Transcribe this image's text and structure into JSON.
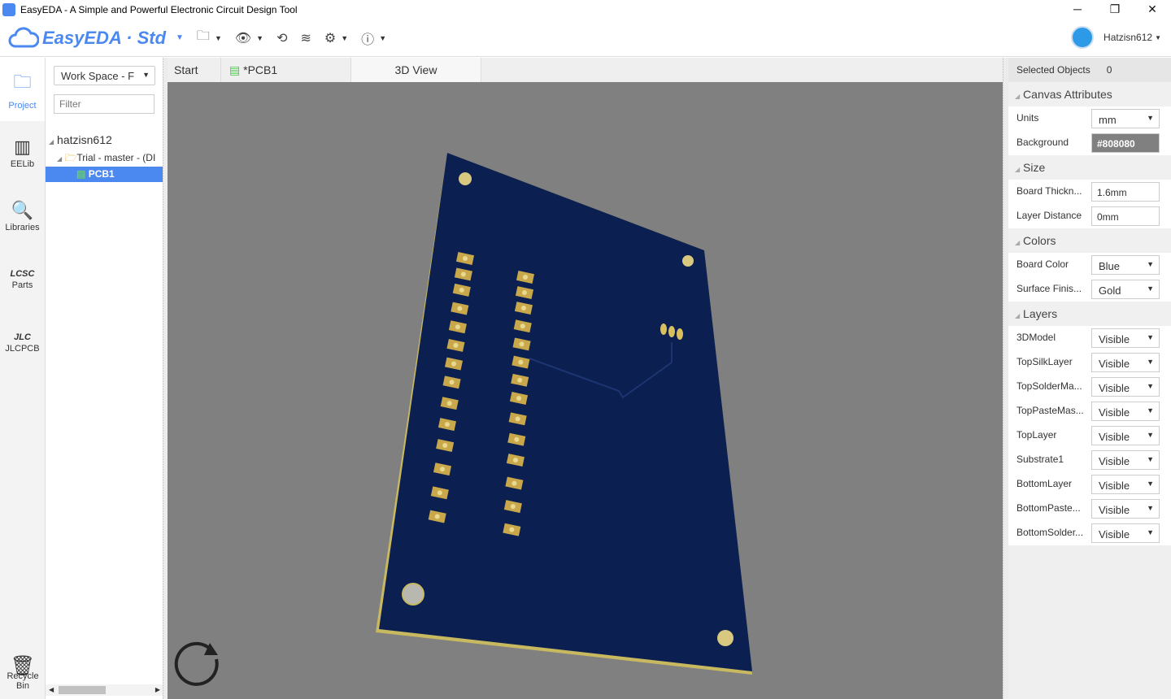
{
  "window": {
    "title": "EasyEDA - A Simple and Powerful Electronic Circuit Design Tool",
    "minimize": "─",
    "restore": "❐",
    "close": "✕"
  },
  "toolbar": {
    "logo": "EasyEDA · Std",
    "user": "Hatzisn612"
  },
  "leftbar": [
    {
      "label": "Project",
      "icon": "folder-icon"
    },
    {
      "label": "EELib",
      "icon": "chip-icon"
    },
    {
      "label": "Libraries",
      "icon": "library-search-icon"
    },
    {
      "label": "Parts",
      "icon": "lcsc-icon"
    },
    {
      "label": "JLCPCB",
      "icon": "jlc-icon"
    }
  ],
  "recycle": {
    "line1": "Recycle",
    "line2": "Bin"
  },
  "project": {
    "workspace": "Work Space - F",
    "filter_placeholder": "Filter",
    "tree": {
      "user": "hatzisn612",
      "project": "Trial - master - (DI",
      "pcb": "PCB1"
    }
  },
  "tabs": [
    {
      "label": "Start"
    },
    {
      "label": "*PCB1"
    },
    {
      "label": "3D View"
    }
  ],
  "panel": {
    "selected_label": "Selected Objects",
    "selected_count": "0",
    "canvas": {
      "title": "Canvas Attributes",
      "units_label": "Units",
      "units": "mm",
      "bg_label": "Background",
      "bg": "#808080"
    },
    "size": {
      "title": "Size",
      "thick_label": "Board Thickn...",
      "thick": "1.6mm",
      "dist_label": "Layer Distance",
      "dist": "0mm"
    },
    "colors": {
      "title": "Colors",
      "board_label": "Board Color",
      "board": "Blue",
      "finish_label": "Surface Finis...",
      "finish": "Gold"
    },
    "layers": {
      "title": "Layers",
      "items": [
        {
          "name": "3DModel",
          "value": "Visible"
        },
        {
          "name": "TopSilkLayer",
          "value": "Visible"
        },
        {
          "name": "TopSolderMa...",
          "value": "Visible"
        },
        {
          "name": "TopPasteMas...",
          "value": "Visible"
        },
        {
          "name": "TopLayer",
          "value": "Visible"
        },
        {
          "name": "Substrate1",
          "value": "Visible"
        },
        {
          "name": "BottomLayer",
          "value": "Visible"
        },
        {
          "name": "BottomPaste...",
          "value": "Visible"
        },
        {
          "name": "BottomSolder...",
          "value": "Visible"
        }
      ]
    }
  },
  "colors": {
    "accent": "#4b88f0",
    "board": "#0b2050",
    "pad": "#c8a84a",
    "canvas": "#808080"
  }
}
